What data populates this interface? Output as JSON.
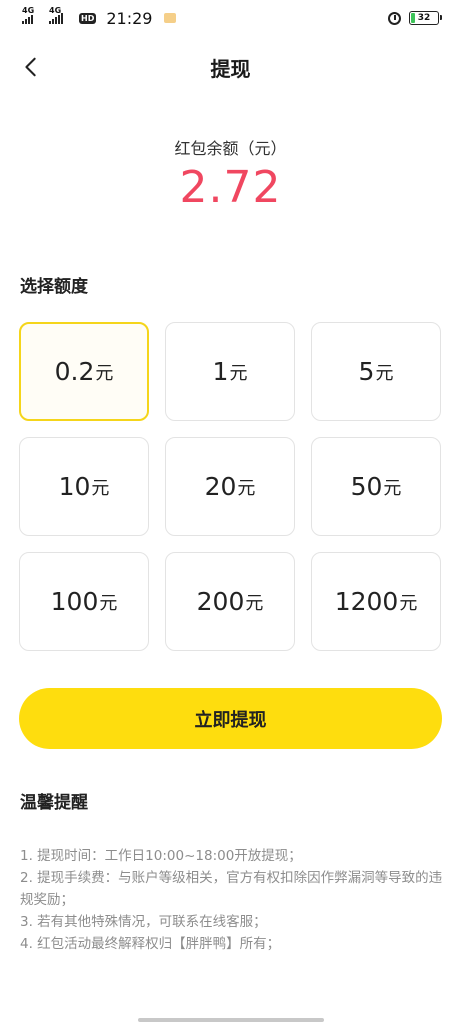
{
  "status_bar": {
    "signal1": "4G",
    "signal2": "4G",
    "hd": "HD",
    "time": "21:29",
    "battery": "32"
  },
  "header": {
    "title": "提现",
    "back_icon": "chevron-left-icon"
  },
  "balance": {
    "label": "红包余额（元）",
    "value": "2.72",
    "color": "#f04760"
  },
  "amount_section": {
    "title": "选择额度",
    "unit": "元",
    "selected_index": 0,
    "options": [
      "0.2",
      "1",
      "5",
      "10",
      "20",
      "50",
      "100",
      "200",
      "1200"
    ]
  },
  "submit": {
    "label": "立即提现",
    "color": "#fedd0e"
  },
  "tips": {
    "title": "温馨提醒",
    "items": [
      "1. 提现时间：工作日10:00~18:00开放提现；",
      "2. 提现手续费：与账户等级相关，官方有权扣除因作弊漏洞等导致的违规奖励；",
      "3. 若有其他特殊情况，可联系在线客服；",
      "4. 红包活动最终解释权归【胖胖鸭】所有；"
    ]
  }
}
